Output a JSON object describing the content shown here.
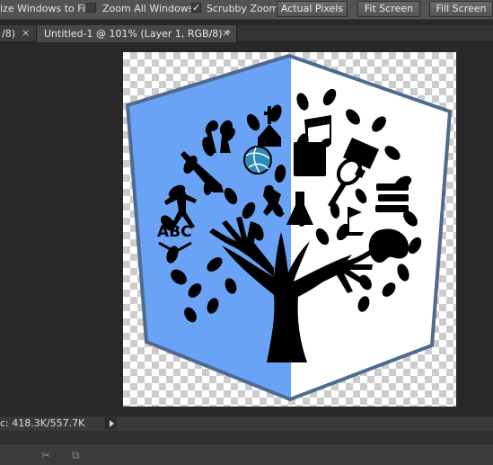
{
  "options_bar": {
    "resize_windows_label": "ize Windows to Fit",
    "zoom_all_windows_label": "Zoom All Windows",
    "zoom_all_windows_checked": false,
    "scrubby_zoom_label": "Scrubby Zoom",
    "scrubby_zoom_checked": true,
    "actual_pixels_label": "Actual Pixels",
    "fit_screen_label": "Fit Screen",
    "fill_screen_label": "Fill Screen"
  },
  "tabs": {
    "partial_label": "/8)",
    "partial_close": "×",
    "active_label": "Untitled-1 @ 101% (Layer 1, RGB/8) *",
    "active_close": "×"
  },
  "canvas": {
    "left_fill_color": "#6aa3f5",
    "right_fill_color": "#ffffff",
    "border_color": "#4f6a8e",
    "artwork_color": "#000000",
    "ball_color": "#2f8bb8",
    "abc_text": "ABC"
  },
  "status_bar": {
    "doc_size": "c: 418.3K/557.7K"
  },
  "bottom_panel": {
    "scissors_icon": "scissors-icon",
    "frame_icon": "crop-frame-icon"
  }
}
